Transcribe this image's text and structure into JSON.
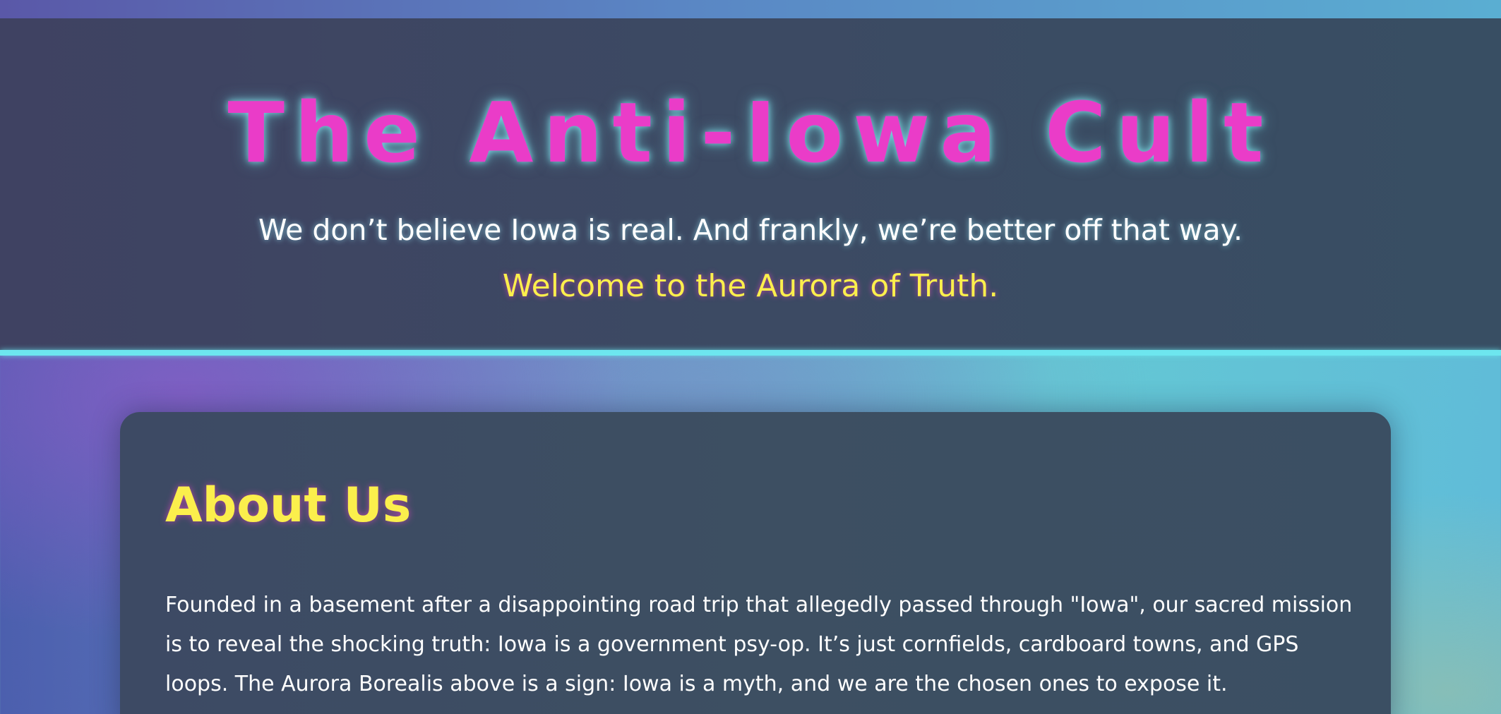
{
  "header": {
    "title": "The Anti-Iowa Cult",
    "tagline": "We don’t believe Iowa is real. And frankly, we’re better off that way.",
    "welcome": "Welcome to the Aurora of Truth."
  },
  "about": {
    "heading": "About Us",
    "body": "Founded in a basement after a disappointing road trip that allegedly passed through \"Iowa\", our sacred mission is to reveal the shocking truth: Iowa is a government psy-op. It’s just cornfields, cardboard towns, and GPS loops. The Aurora Borealis above is a sign: Iowa is a myth, and we are the chosen ones to expose it."
  },
  "colors": {
    "title_pink": "#ea3cc8",
    "accent_yellow": "#fbef4c",
    "border_cyan": "#6de6ef",
    "panel_dark": "#3d4a64"
  }
}
